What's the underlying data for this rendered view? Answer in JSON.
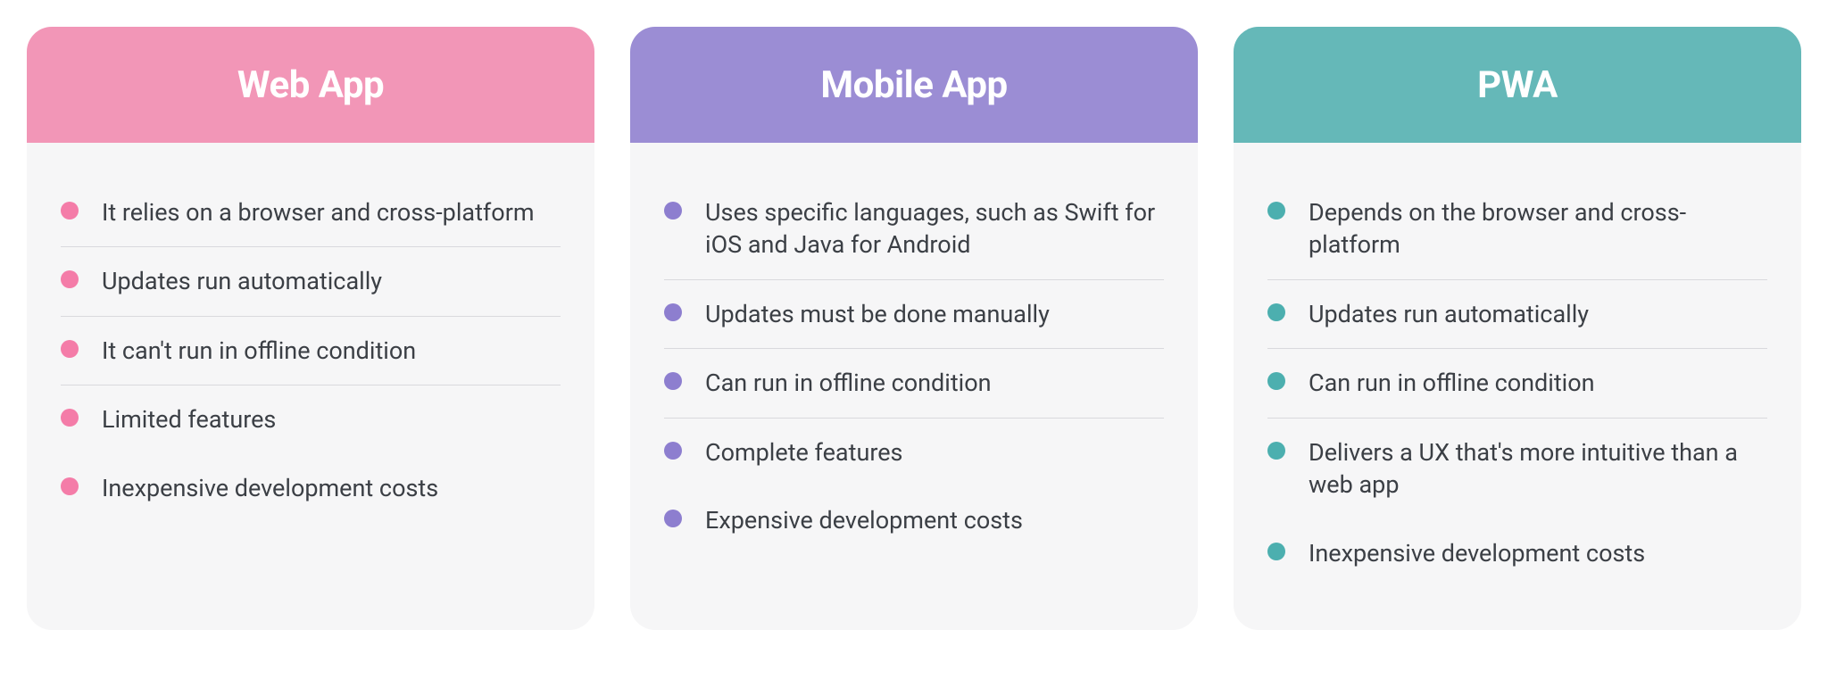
{
  "cards": [
    {
      "title": "Web App",
      "colorClass": "pink",
      "items": [
        {
          "text": "It relies on a browser and cross-platform",
          "border": true
        },
        {
          "text": "Updates run automatically",
          "border": true
        },
        {
          "text": "It can't run in offline condition",
          "border": true
        },
        {
          "text": "Limited features",
          "border": false
        },
        {
          "text": "Inexpensive development costs",
          "border": false
        }
      ]
    },
    {
      "title": "Mobile App",
      "colorClass": "purple",
      "items": [
        {
          "text": "Uses specific languages, such as Swift for iOS and Java for Android",
          "border": true
        },
        {
          "text": "Updates must be done manually",
          "border": true
        },
        {
          "text": "Can run in offline condition",
          "border": true
        },
        {
          "text": "Complete features",
          "border": false
        },
        {
          "text": "Expensive development costs",
          "border": false
        }
      ]
    },
    {
      "title": "PWA",
      "colorClass": "teal",
      "items": [
        {
          "text": "Depends on the browser and cross-platform",
          "border": true
        },
        {
          "text": "Updates run automatically",
          "border": true
        },
        {
          "text": "Can run in offline condition",
          "border": true
        },
        {
          "text": "Delivers a UX that's more intuitive than a web app",
          "border": false
        },
        {
          "text": "Inexpensive development costs",
          "border": false
        }
      ]
    }
  ]
}
